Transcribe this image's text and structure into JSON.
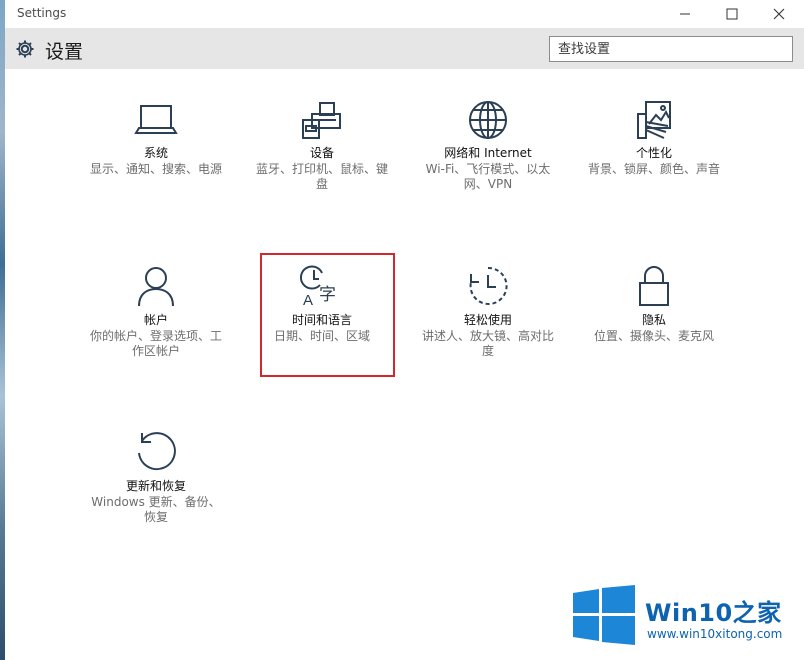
{
  "window": {
    "app_title": "Settings",
    "minimize_icon": "minimize-icon",
    "maximize_icon": "maximize-icon",
    "close_icon": "close-icon"
  },
  "header": {
    "title": "设置",
    "icon": "gear-icon",
    "search_placeholder": "查找设置"
  },
  "tiles": [
    {
      "id": "system",
      "icon": "laptop-icon",
      "title": "系统",
      "desc": "显示、通知、搜索、电源"
    },
    {
      "id": "devices",
      "icon": "printer-icon",
      "title": "设备",
      "desc": "蓝牙、打印机、鼠标、键盘"
    },
    {
      "id": "network",
      "icon": "globe-icon",
      "title": "网络和 Internet",
      "desc": "Wi-Fi、飞行模式、以太网、VPN"
    },
    {
      "id": "personalization",
      "icon": "paint-palette-icon",
      "title": "个性化",
      "desc": "背景、锁屏、颜色、声音"
    },
    {
      "id": "accounts",
      "icon": "person-icon",
      "title": "帐户",
      "desc": "你的帐户、登录选项、工作区帐户"
    },
    {
      "id": "time-language",
      "icon": "clock-language-icon",
      "title": "时间和语言",
      "desc": "日期、时间、区域"
    },
    {
      "id": "ease-of-access",
      "icon": "ease-of-access-icon",
      "title": "轻松使用",
      "desc": "讲述人、放大镜、高对比度"
    },
    {
      "id": "privacy",
      "icon": "lock-icon",
      "title": "隐私",
      "desc": "位置、摄像头、麦克风"
    },
    {
      "id": "update-security",
      "icon": "refresh-icon",
      "title": "更新和恢复",
      "desc": "Windows 更新、备份、恢复"
    }
  ],
  "watermark": {
    "brand": "Win10之家",
    "url": "www.win10xitong.com",
    "logo": "windows-logo-icon"
  },
  "colors": {
    "icon": "#2b3f55",
    "highlight": "#d0282c",
    "header_bg": "#e6e6e6",
    "watermark": "#0d63b0"
  }
}
